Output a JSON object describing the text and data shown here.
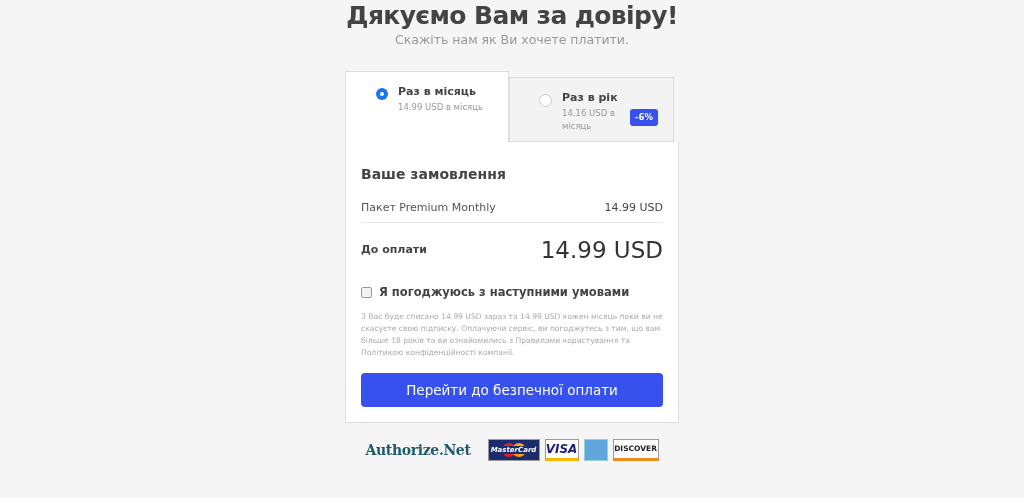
{
  "title": "Дякуємо Вам за довіру!",
  "subtitle": "Скажіть нам як Ви хочете платити.",
  "plans": [
    {
      "name": "Раз в місяць",
      "price": "14.99 USD в місяць",
      "selected": true
    },
    {
      "name": "Раз в рік",
      "price": "14.16 USD в місяць",
      "selected": false,
      "badge": "-6%"
    }
  ],
  "order": {
    "heading": "Ваше замовлення",
    "item": "Пакет Premium Monthly",
    "item_price": "14.99 USD",
    "total_label": "До оплати",
    "total": "14.99 USD",
    "agree": {
      "label": "Я погоджуюсь з наступними умовами",
      "checked": false
    },
    "note": "З Вас буде списано 14.99 USD зараз та 14.99 USD кожен місяць поки ви не скасуєте свою підписку. Оплачуючи сервіс, ви погоджутесь з тим, що вам більше 18 років та ви ознайомились з Правилами користування та Політикою конфіденційності компанії.",
    "button": "Перейти до безпечної оплати"
  },
  "footer": {
    "gateway": "Authorize.Net",
    "cards": [
      {
        "kind": "mastercard",
        "label": "MasterCard"
      },
      {
        "kind": "visa",
        "label": "VISA"
      },
      {
        "kind": "amex"
      },
      {
        "kind": "discover",
        "label": "DISCOVER"
      }
    ]
  }
}
